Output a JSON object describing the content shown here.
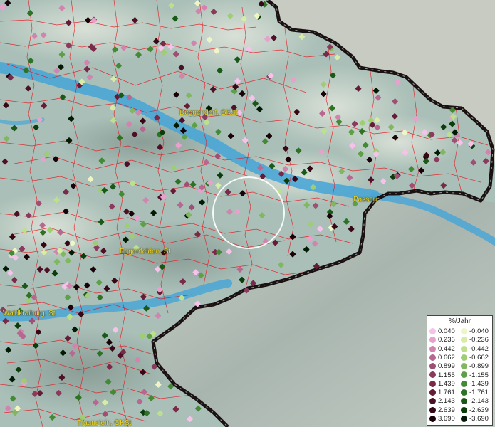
{
  "map": {
    "places": [
      {
        "id": "deggendorf",
        "name": "Deggendorf, GKSt"
      },
      {
        "id": "passau",
        "name": "Passau"
      },
      {
        "id": "eggenfelden",
        "name": "Eggenfelden, St"
      },
      {
        "id": "waldkraiburg",
        "name": "Waldkraiburg, St"
      },
      {
        "id": "traunstein",
        "name": "Traunstein, GKSt"
      }
    ],
    "colors": {
      "water": "#4aa6d6",
      "border": "#1a1212",
      "admin_lines": "#e8141e",
      "highlight_circle": "#ffffff"
    }
  },
  "legend": {
    "title": "%/Jahr",
    "positive": [
      {
        "label": "0.040",
        "color": "#f7c2ea"
      },
      {
        "label": "0.236",
        "color": "#e7a1cc"
      },
      {
        "label": "0.442",
        "color": "#d184ae"
      },
      {
        "label": "0.662",
        "color": "#b86890"
      },
      {
        "label": "0.899",
        "color": "#a04f74"
      },
      {
        "label": "1.155",
        "color": "#8b3a5c"
      },
      {
        "label": "1.439",
        "color": "#7a2a49"
      },
      {
        "label": "1.761",
        "color": "#651c37"
      },
      {
        "label": "2.143",
        "color": "#4e1026"
      },
      {
        "label": "2.639",
        "color": "#360714"
      },
      {
        "label": "3.690",
        "color": "#180207"
      }
    ],
    "negative": [
      {
        "label": "-0.040",
        "color": "#f0f5c6"
      },
      {
        "label": "-0.236",
        "color": "#d7eca5"
      },
      {
        "label": "-0.442",
        "color": "#bde08c"
      },
      {
        "label": "-0.662",
        "color": "#9ecd74"
      },
      {
        "label": "-0.899",
        "color": "#80b75f"
      },
      {
        "label": "-1.155",
        "color": "#5f9f48"
      },
      {
        "label": "-1.439",
        "color": "#438936"
      },
      {
        "label": "-1.761",
        "color": "#2e7226"
      },
      {
        "label": "-2.143",
        "color": "#1a5818"
      },
      {
        "label": "-2.639",
        "color": "#0b3d0c"
      },
      {
        "label": "-3.690",
        "color": "#021a03"
      }
    ]
  }
}
